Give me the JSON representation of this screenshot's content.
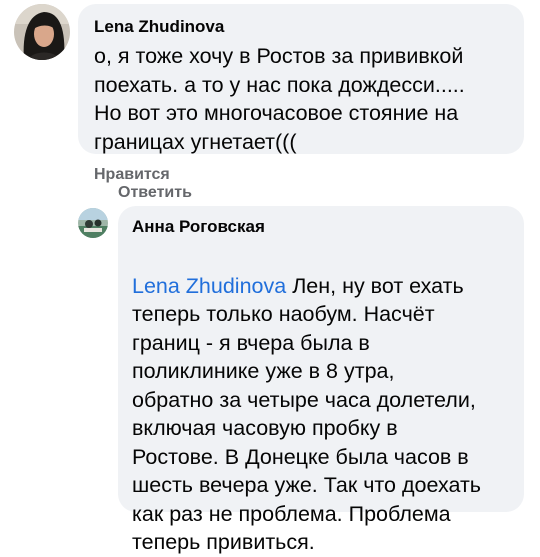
{
  "comments": [
    {
      "author": "Lena Zhudinova",
      "text": "о, я тоже хочу в Ростов за прививкой\nпоехать. а то у нас пока дождесси.....\nНо вот это многочасовое стояние на\nграницах угнетает(((",
      "avatar_icon": "user-avatar-photo",
      "actions": {
        "like": "Нравится",
        "reply": "Ответить"
      }
    },
    {
      "author": "Анна Роговская",
      "mention": "Lena Zhudinova",
      "text_first_line": " Лен, ну вот ехать",
      "text": "теперь только наобум. Насчёт\nграниц - я вчера была в\nполиклинике уже в 8 утра,\nобратно за четыре часа долетели,\nвключая часовую пробку в\nРостове. В Донецке была часов в\nшесть вечера уже. Так что доехать\nкак раз не проблема. Проблема\nтеперь привиться.",
      "avatar_icon": "user-avatar-photo"
    }
  ],
  "colors": {
    "bubble": "#f0f2f5",
    "mention": "#216fdb",
    "action_text": "#65676b"
  }
}
